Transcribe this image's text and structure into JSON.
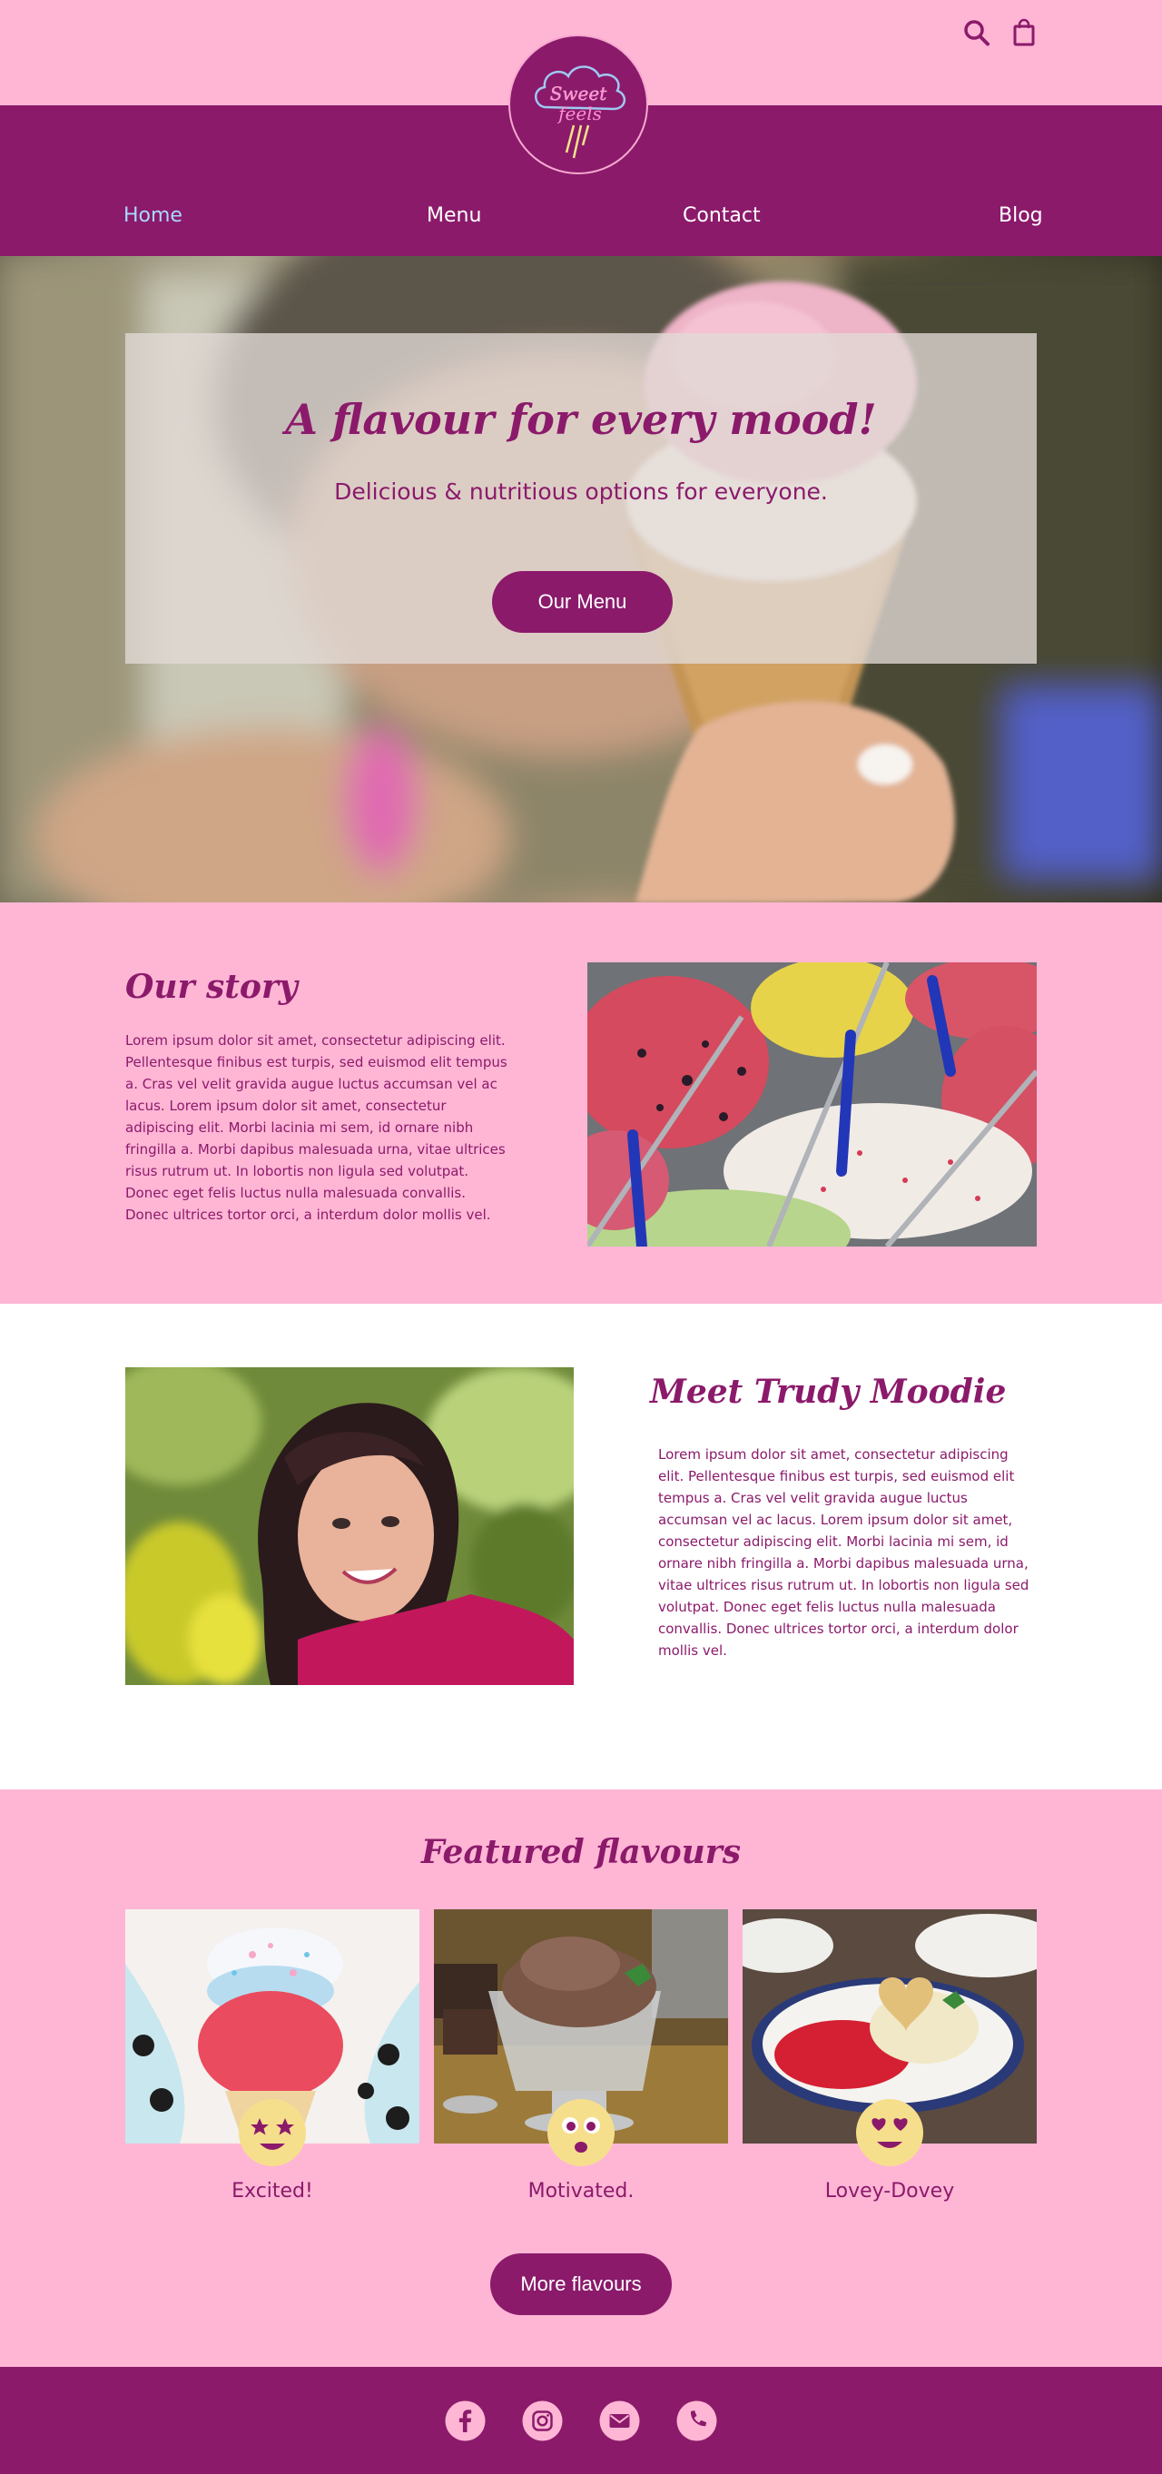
{
  "header": {
    "search_icon": "search-icon",
    "cart_icon": "shopping-bag-icon",
    "logo_text_line1": "Sweet",
    "logo_text_line2": "feels"
  },
  "nav": {
    "items": [
      {
        "label": "Home",
        "active": true
      },
      {
        "label": "Menu",
        "active": false
      },
      {
        "label": "Contact",
        "active": false
      },
      {
        "label": "Blog",
        "active": false
      }
    ]
  },
  "hero": {
    "title": "A flavour for every mood!",
    "subtitle": "Delicious & nutritious options for everyone.",
    "button_label": "Our Menu"
  },
  "story": {
    "title": "Our story",
    "text": "Lorem ipsum dolor sit amet, consectetur adipiscing elit. Pellentesque finibus est turpis, sed euismod elit tempus a. Cras vel velit gravida augue luctus accumsan vel ac lacus. Lorem ipsum dolor sit amet, consectetur adipiscing elit. Morbi lacinia mi sem, id ornare nibh fringilla a. Morbi dapibus malesuada urna, vitae ultrices risus rutrum ut. In lobortis non ligula sed volutpat. Donec eget felis luctus nulla malesuada convallis. Donec ultrices tortor orci, a interdum dolor mollis vel."
  },
  "trudy": {
    "title": "Meet Trudy Moodie",
    "text": "Lorem ipsum dolor sit amet, consectetur adipiscing elit. Pellentesque finibus est turpis, sed euismod elit tempus a. Cras vel velit gravida augue luctus accumsan vel ac lacus. Lorem ipsum dolor sit amet, consectetur adipiscing elit. Morbi lacinia mi sem, id ornare nibh fringilla a. Morbi dapibus malesuada urna, vitae ultrices risus rutrum ut. In lobortis non ligula sed volutpat. Donec eget felis luctus nulla malesuada convallis. Donec ultrices tortor orci, a interdum dolor mollis vel."
  },
  "featured": {
    "title": "Featured flavours",
    "cards": [
      {
        "label": "Excited!",
        "emoji": "star-eyes-emoji"
      },
      {
        "label": "Motivated.",
        "emoji": "wide-eyes-emoji"
      },
      {
        "label": "Lovey-Dovey",
        "emoji": "heart-eyes-emoji"
      }
    ],
    "more_label": "More flavours"
  },
  "footer": {
    "social": [
      "facebook-icon",
      "instagram-icon",
      "mail-icon",
      "phone-icon"
    ]
  },
  "colors": {
    "brand_purple": "#8b1a6b",
    "pink_background": "#ffb6d5",
    "active_nav": "#a9d8ff",
    "emoji_yellow": "#f6df8c"
  }
}
